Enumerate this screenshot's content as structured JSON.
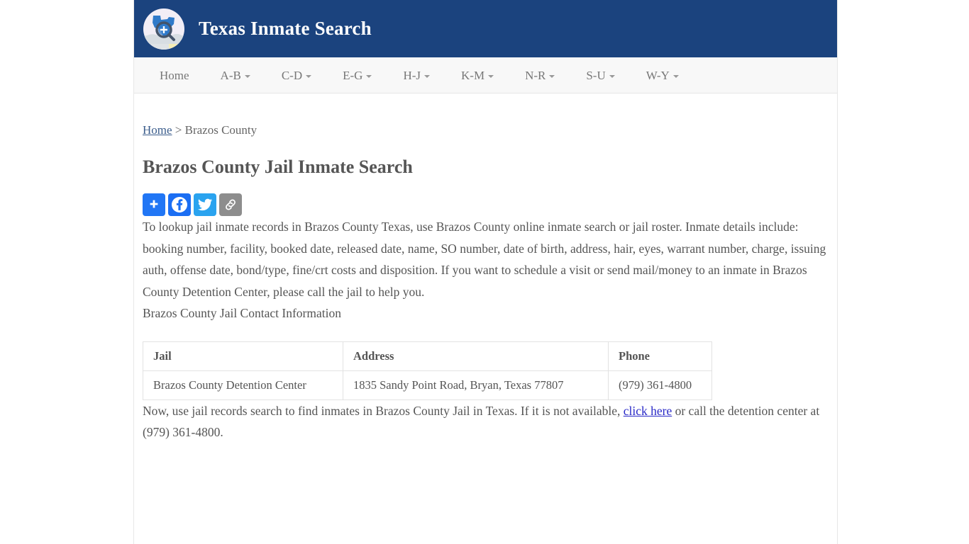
{
  "site": {
    "title": "Texas Inmate Search",
    "logo_icon": "texas-magnifier-icon",
    "header_bg": "#1b437e"
  },
  "nav": {
    "items": [
      {
        "label": "Home",
        "has_dropdown": false
      },
      {
        "label": "A-B",
        "has_dropdown": true
      },
      {
        "label": "C-D",
        "has_dropdown": true
      },
      {
        "label": "E-G",
        "has_dropdown": true
      },
      {
        "label": "H-J",
        "has_dropdown": true
      },
      {
        "label": "K-M",
        "has_dropdown": true
      },
      {
        "label": "N-R",
        "has_dropdown": true
      },
      {
        "label": "S-U",
        "has_dropdown": true
      },
      {
        "label": "W-Y",
        "has_dropdown": true
      }
    ]
  },
  "breadcrumb": {
    "home": "Home",
    "separator": "> ",
    "current": "Brazos County"
  },
  "page": {
    "title": "Brazos County Jail Inmate Search"
  },
  "share": {
    "buttons": [
      {
        "name": "addthis-share-icon",
        "label": "+",
        "color": "#2176f5"
      },
      {
        "name": "facebook-icon",
        "label": "Facebook",
        "color": "#1b6ef3"
      },
      {
        "name": "twitter-icon",
        "label": "Twitter",
        "color": "#2aa3ef"
      },
      {
        "name": "copy-link-icon",
        "label": "Copy Link",
        "color": "#8d8d8d"
      }
    ]
  },
  "content": {
    "paragraph_1": "To lookup jail inmate records in Brazos County Texas, use Brazos County online inmate search or jail roster. Inmate details include: booking number, facility, booked date, released date, name, SO number, date of birth, address, hair, eyes, warrant number, charge, issuing auth, offense date, bond/type, fine/crt costs and disposition. If you want to schedule a visit or send mail/money to an inmate in Brazos County Detention Center, please call the jail to help you.",
    "contact_heading": "Brazos County Jail Contact Information",
    "paragraph_3_before_link": "Now, use jail records search to find inmates in Brazos County Jail in Texas. If it is not available, ",
    "paragraph_3_link": "click here",
    "paragraph_3_after_link": " or call the detention center at (979) 361-4800."
  },
  "contact_table": {
    "headers": [
      "Jail",
      "Address",
      "Phone"
    ],
    "rows": [
      {
        "jail": "Brazos County Detention Center",
        "address": "1835 Sandy Point Road, Bryan, Texas 77807",
        "phone": "(979) 361-4800"
      }
    ]
  }
}
